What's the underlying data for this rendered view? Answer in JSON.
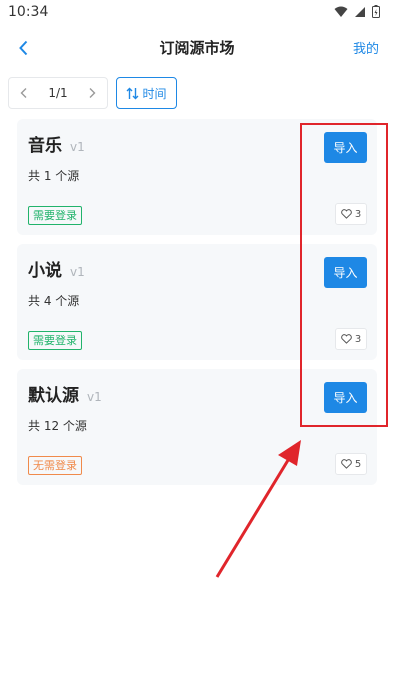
{
  "status": {
    "time": "10:34"
  },
  "nav": {
    "title": "订阅源市场",
    "mine": "我的"
  },
  "pager": {
    "text": "1/1"
  },
  "sort": {
    "label": "时间"
  },
  "cards": [
    {
      "name": "音乐",
      "version": "v1",
      "count": "共 1 个源",
      "tag": "需要登录",
      "import_label": "导入",
      "likes": "3"
    },
    {
      "name": "小说",
      "version": "v1",
      "count": "共 4 个源",
      "tag": "需要登录",
      "import_label": "导入",
      "likes": "3"
    },
    {
      "name": "默认源",
      "version": "v1",
      "count": "共 12 个源",
      "tag": "无需登录",
      "import_label": "导入",
      "likes": "5"
    }
  ],
  "colors": {
    "accent": "#1e88e5",
    "tag_green": "#21b36b",
    "tag_orange": "#f08a4b",
    "annotation_red": "#e0252b"
  }
}
